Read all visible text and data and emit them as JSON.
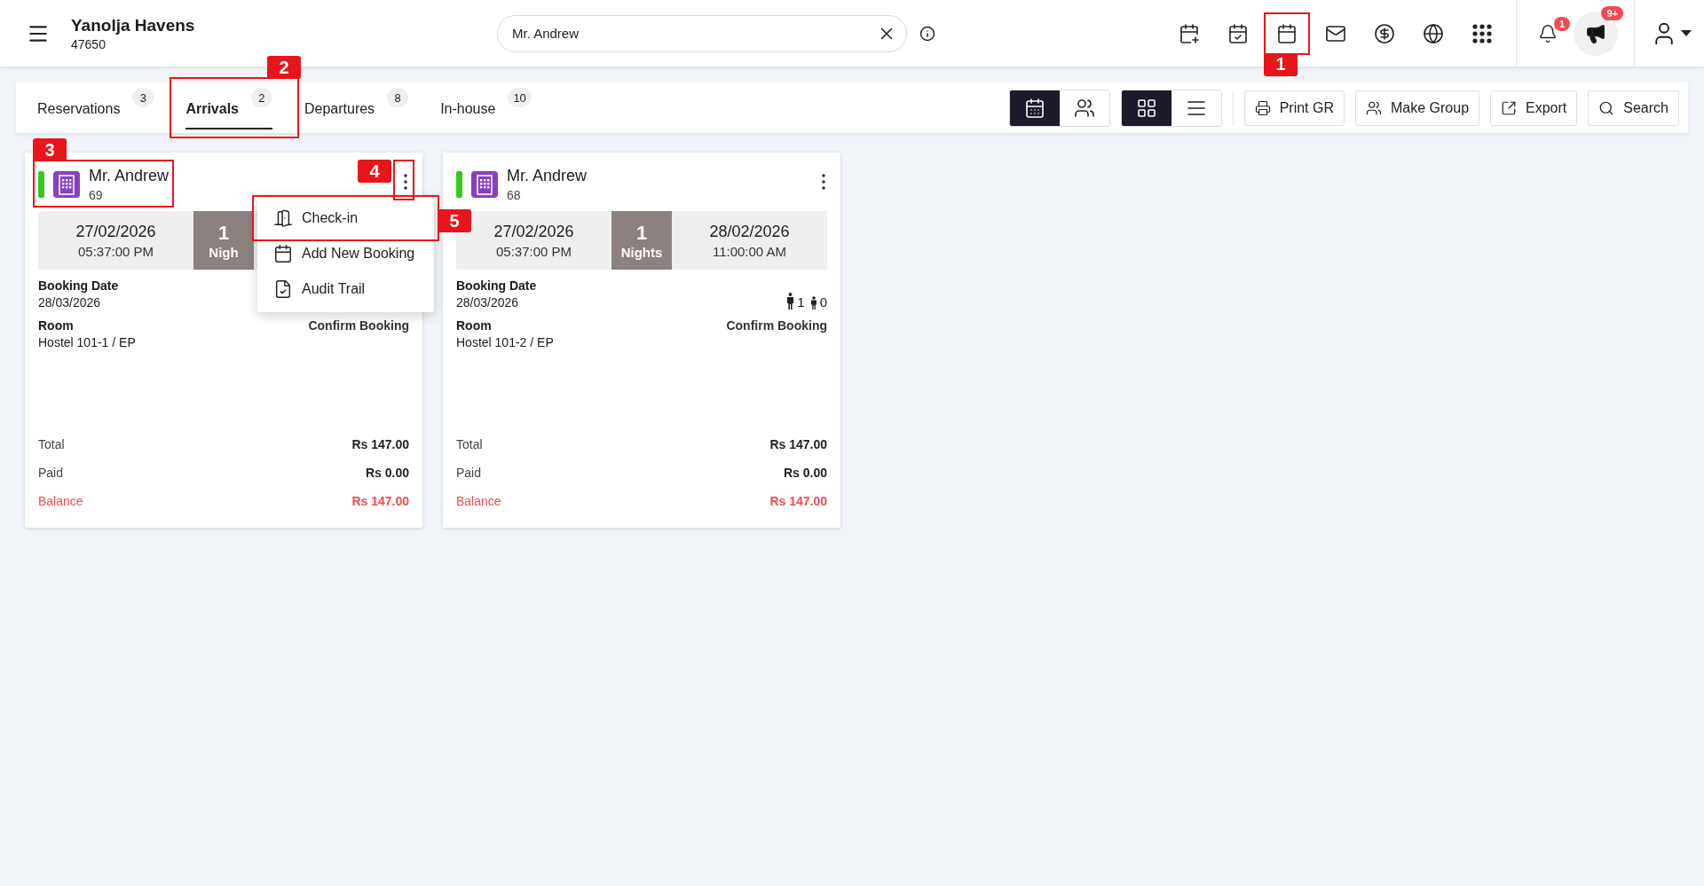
{
  "header": {
    "title": "Yanolja Havens",
    "subtitle": "47650",
    "search": {
      "value": "Mr. Andrew"
    },
    "actions": [
      {
        "kind": "calendar-add"
      },
      {
        "kind": "calendar-check"
      },
      {
        "kind": "calendar",
        "callout": "1"
      },
      {
        "kind": "mail"
      },
      {
        "kind": "dollar"
      },
      {
        "kind": "globe"
      },
      {
        "kind": "apps"
      }
    ],
    "notifications": {
      "count": "1"
    },
    "announcements": {
      "count": "9+"
    }
  },
  "tabs": [
    {
      "label": "Reservations",
      "count": "3",
      "selected": false
    },
    {
      "label": "Arrivals",
      "count": "2",
      "selected": true,
      "callout": "2"
    },
    {
      "label": "Departures",
      "count": "8",
      "selected": false
    },
    {
      "label": "In-house",
      "count": "10",
      "selected": false
    }
  ],
  "view_modes": [
    {
      "kind": "guest",
      "selected": true
    },
    {
      "kind": "group",
      "selected": false
    }
  ],
  "layouts": [
    {
      "kind": "grid",
      "selected": true
    },
    {
      "kind": "list",
      "selected": false
    }
  ],
  "toolbar_buttons": [
    {
      "kind": "print",
      "label": "Print GR"
    },
    {
      "kind": "group",
      "label": "Make Group"
    },
    {
      "kind": "export",
      "label": "Export"
    },
    {
      "kind": "search",
      "label": "Search"
    }
  ],
  "cards": [
    {
      "name": "Mr. Andrew",
      "number": "69",
      "color": "#36c71b",
      "callout": "3",
      "menu_callout": "4",
      "arrival": {
        "date": "27/02/2026",
        "time": "05:37:00 PM"
      },
      "nights": {
        "count": "1",
        "label": "Nigh"
      },
      "booking_date_label": "Booking Date",
      "booking_date": "28/03/2026",
      "room_label": "Room",
      "room": "Hostel 101-1 / EP",
      "status": "Confirm Booking",
      "totals": [
        {
          "kind": "normal",
          "label": "Total",
          "value": "Rs 147.00"
        },
        {
          "kind": "normal",
          "label": "Paid",
          "value": "Rs 0.00"
        },
        {
          "kind": "balance",
          "label": "Balance",
          "value": "Rs 147.00"
        }
      ],
      "menu": [
        {
          "kind": "check-in",
          "label": "Check-in",
          "callout": "5"
        },
        {
          "kind": "add-booking",
          "label": "Add New Booking"
        },
        {
          "kind": "audit",
          "label": "Audit Trail"
        }
      ]
    },
    {
      "name": "Mr. Andrew",
      "number": "68",
      "color": "#36c71b",
      "arrival": {
        "date": "27/02/2026",
        "time": "05:37:00 PM"
      },
      "nights": {
        "count": "1",
        "label": "Nights"
      },
      "departure": {
        "date": "28/02/2026",
        "time": "11:00:00 AM"
      },
      "booking_date_label": "Booking Date",
      "booking_date": "28/03/2026",
      "guests": {
        "adults": "1",
        "children": "0"
      },
      "room_label": "Room",
      "room": "Hostel 101-2 / EP",
      "status": "Confirm Booking",
      "totals": [
        {
          "kind": "normal",
          "label": "Total",
          "value": "Rs 147.00"
        },
        {
          "kind": "normal",
          "label": "Paid",
          "value": "Rs 0.00"
        },
        {
          "kind": "balance",
          "label": "Balance",
          "value": "Rs 147.00"
        }
      ]
    }
  ]
}
